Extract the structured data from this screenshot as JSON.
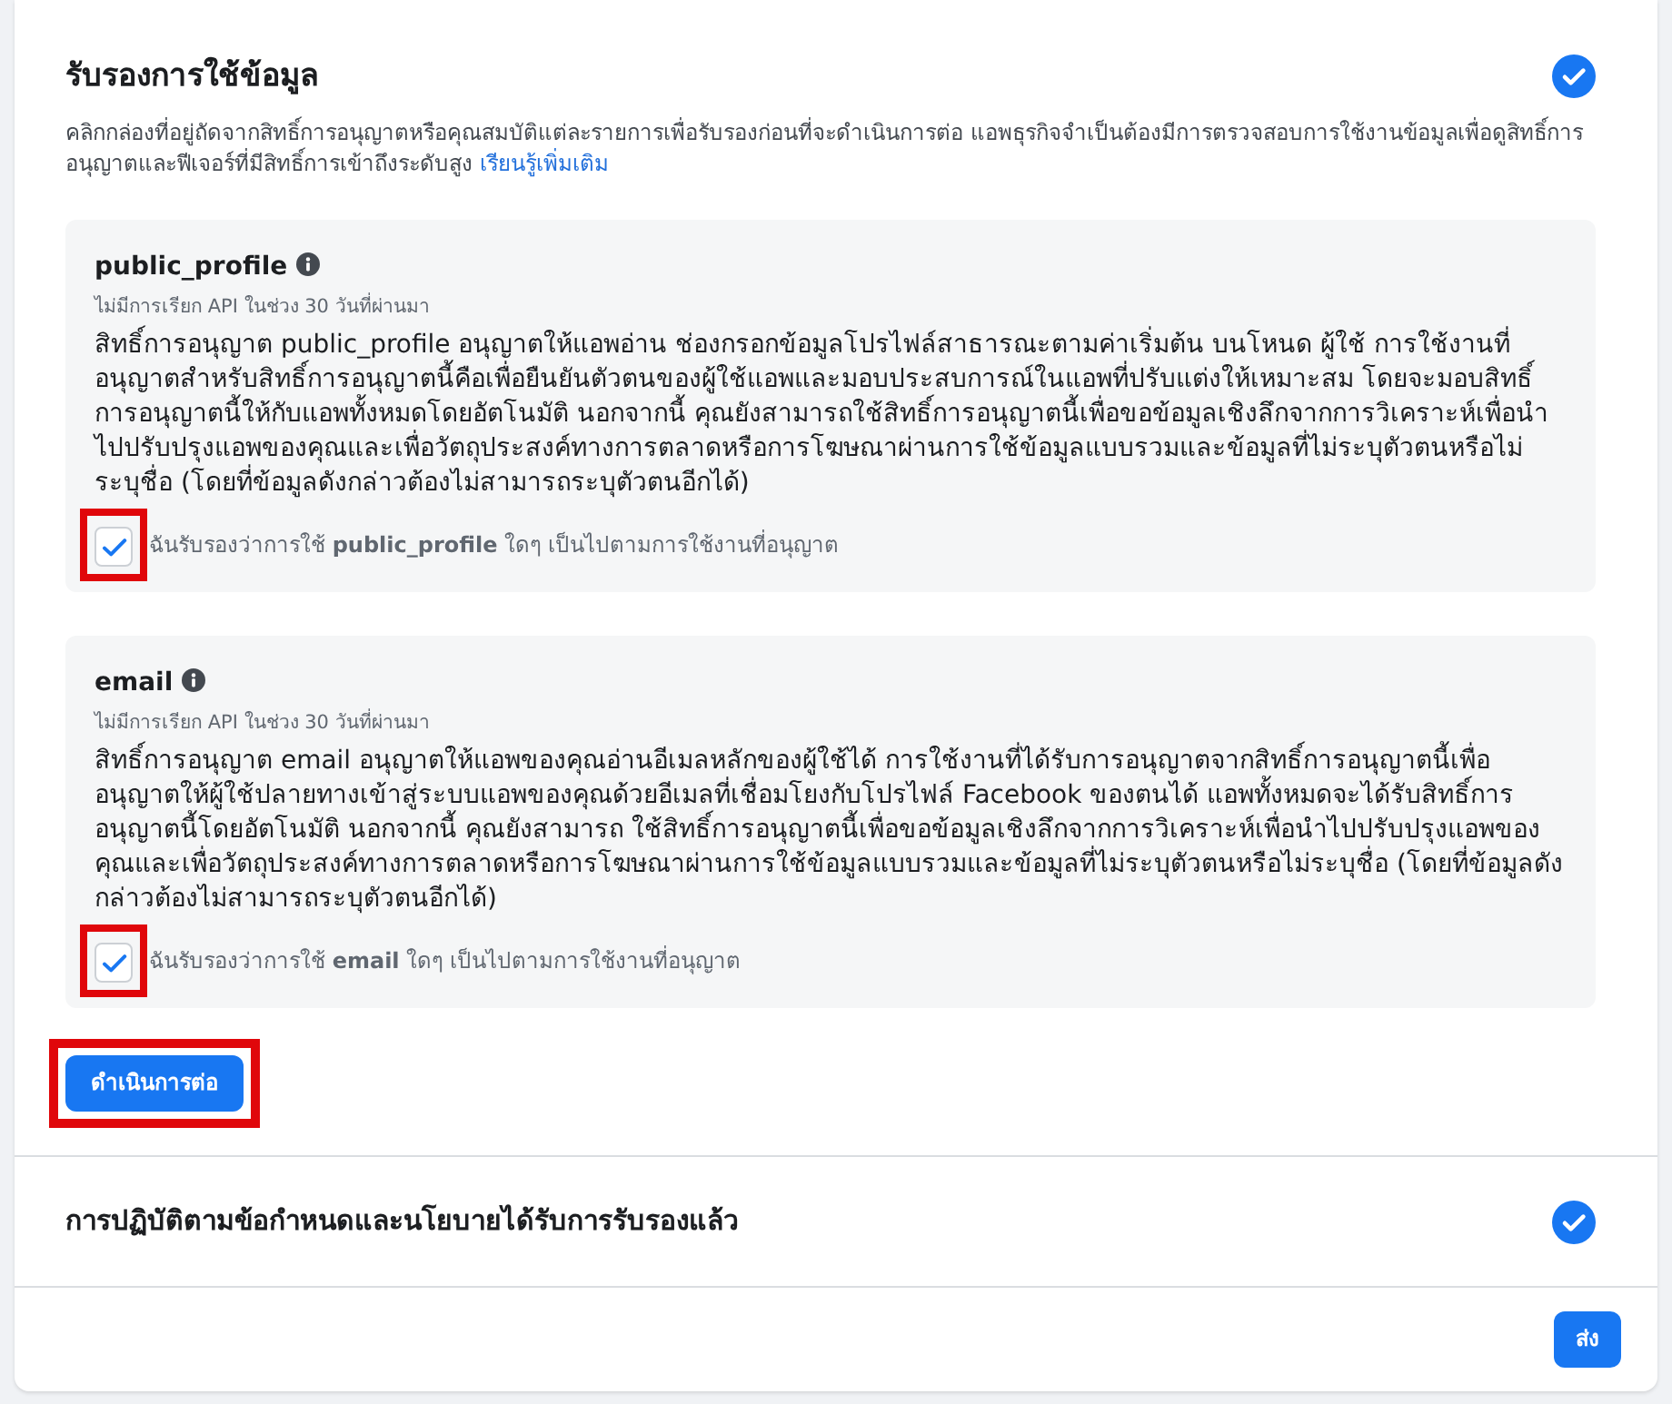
{
  "sections": [
    {
      "kind": "certify",
      "title": "รับรองการใช้ข้อมูล",
      "verified": true,
      "description": "คลิกกล่องที่อยู่ถัดจากสิทธิ์การอนุญาตหรือคุณสมบัติแต่ละรายการเพื่อรับรองก่อนที่จะดำเนินการต่อ แอพธุรกิจจำเป็นต้องมีการตรวจสอบการใช้งานข้อมูลเพื่อดูสิทธิ์การอนุญาตและฟีเจอร์ที่มีสิทธิ์การเข้าถึงระดับสูง",
      "link": "เรียนรู้เพิ่มเติม",
      "permissions": [
        {
          "name": "public_profile",
          "api_note": "ไม่มีการเรียก API ในช่วง 30 วันที่ผ่านมา",
          "description": "สิทธิ์การอนุญาต public_profile อนุญาตให้แอพอ่าน ช่องกรอกข้อมูลโปรไฟล์สาธารณะตามค่าเริ่มต้น บนโหนด ผู้ใช้ การใช้งานที่อนุญาตสำหรับสิทธิ์การอนุญาตนี้คือเพื่อยืนยันตัวตนของผู้ใช้แอพและมอบประสบการณ์ในแอพที่ปรับแต่งให้เหมาะสม โดยจะมอบสิทธิ์การอนุญาตนี้ให้กับแอพทั้งหมดโดยอัตโนมัติ นอกจากนี้ คุณยังสามารถใช้สิทธิ์การอนุญาตนี้เพื่อขอข้อมูลเชิงลึกจากการวิเคราะห์เพื่อนำไปปรับปรุงแอพของคุณและเพื่อวัตถุประสงค์ทางการตลาดหรือการโฆษณาผ่านการใช้ข้อมูลแบบรวมและข้อมูลที่ไม่ระบุตัวตนหรือไม่ระบุชื่อ (โดยที่ข้อมูลดังกล่าวต้องไม่สามารถระบุตัวตนอีกได้)",
          "certify_label": "ฉันรับรองว่าการใช้ **public_profile** ใดๆ เป็นไปตามการใช้งานที่อนุญาต",
          "checked": true,
          "highlighted": true
        },
        {
          "name": "email",
          "api_note": "ไม่มีการเรียก API ในช่วง 30 วันที่ผ่านมา",
          "description": "สิทธิ์การอนุญาต email อนุญาตให้แอพของคุณอ่านอีเมลหลักของผู้ใช้ได้ การใช้งานที่ได้รับการอนุญาตจากสิทธิ์การอนุญาตนี้เพื่ออนุญาตให้ผู้ใช้ปลายทางเข้าสู่ระบบแอพของคุณด้วยอีเมลที่เชื่อมโยงกับโปรไฟล์ Facebook ของตนได้ แอพทั้งหมดจะได้รับสิทธิ์การอนุญาตนี้โดยอัตโนมัติ นอกจากนี้ คุณยังสามารถ ใช้สิทธิ์การอนุญาตนี้เพื่อขอข้อมูลเชิงลึกจากการวิเคราะห์เพื่อนำไปปรับปรุงแอพของคุณและเพื่อวัตถุประสงค์ทางการตลาดหรือการโฆษณาผ่านการใช้ข้อมูลแบบรวมและข้อมูลที่ไม่ระบุตัวตนหรือไม่ระบุชื่อ (โดยที่ข้อมูลดังกล่าวต้องไม่สามารถระบุตัวตนอีกได้)",
          "certify_label": "ฉันรับรองว่าการใช้ **email** ใดๆ เป็นไปตามการใช้งานที่อนุญาต",
          "checked": true,
          "highlighted": true
        }
      ],
      "continue_button": {
        "label": "ดำเนินการต่อ",
        "highlighted": true
      }
    },
    {
      "kind": "status",
      "title": "การปฏิบัติตามข้อกำหนดและนโยบายได้รับการรับรองแล้ว",
      "verified": true
    }
  ],
  "submit_button": {
    "label": "ส่ง"
  }
}
